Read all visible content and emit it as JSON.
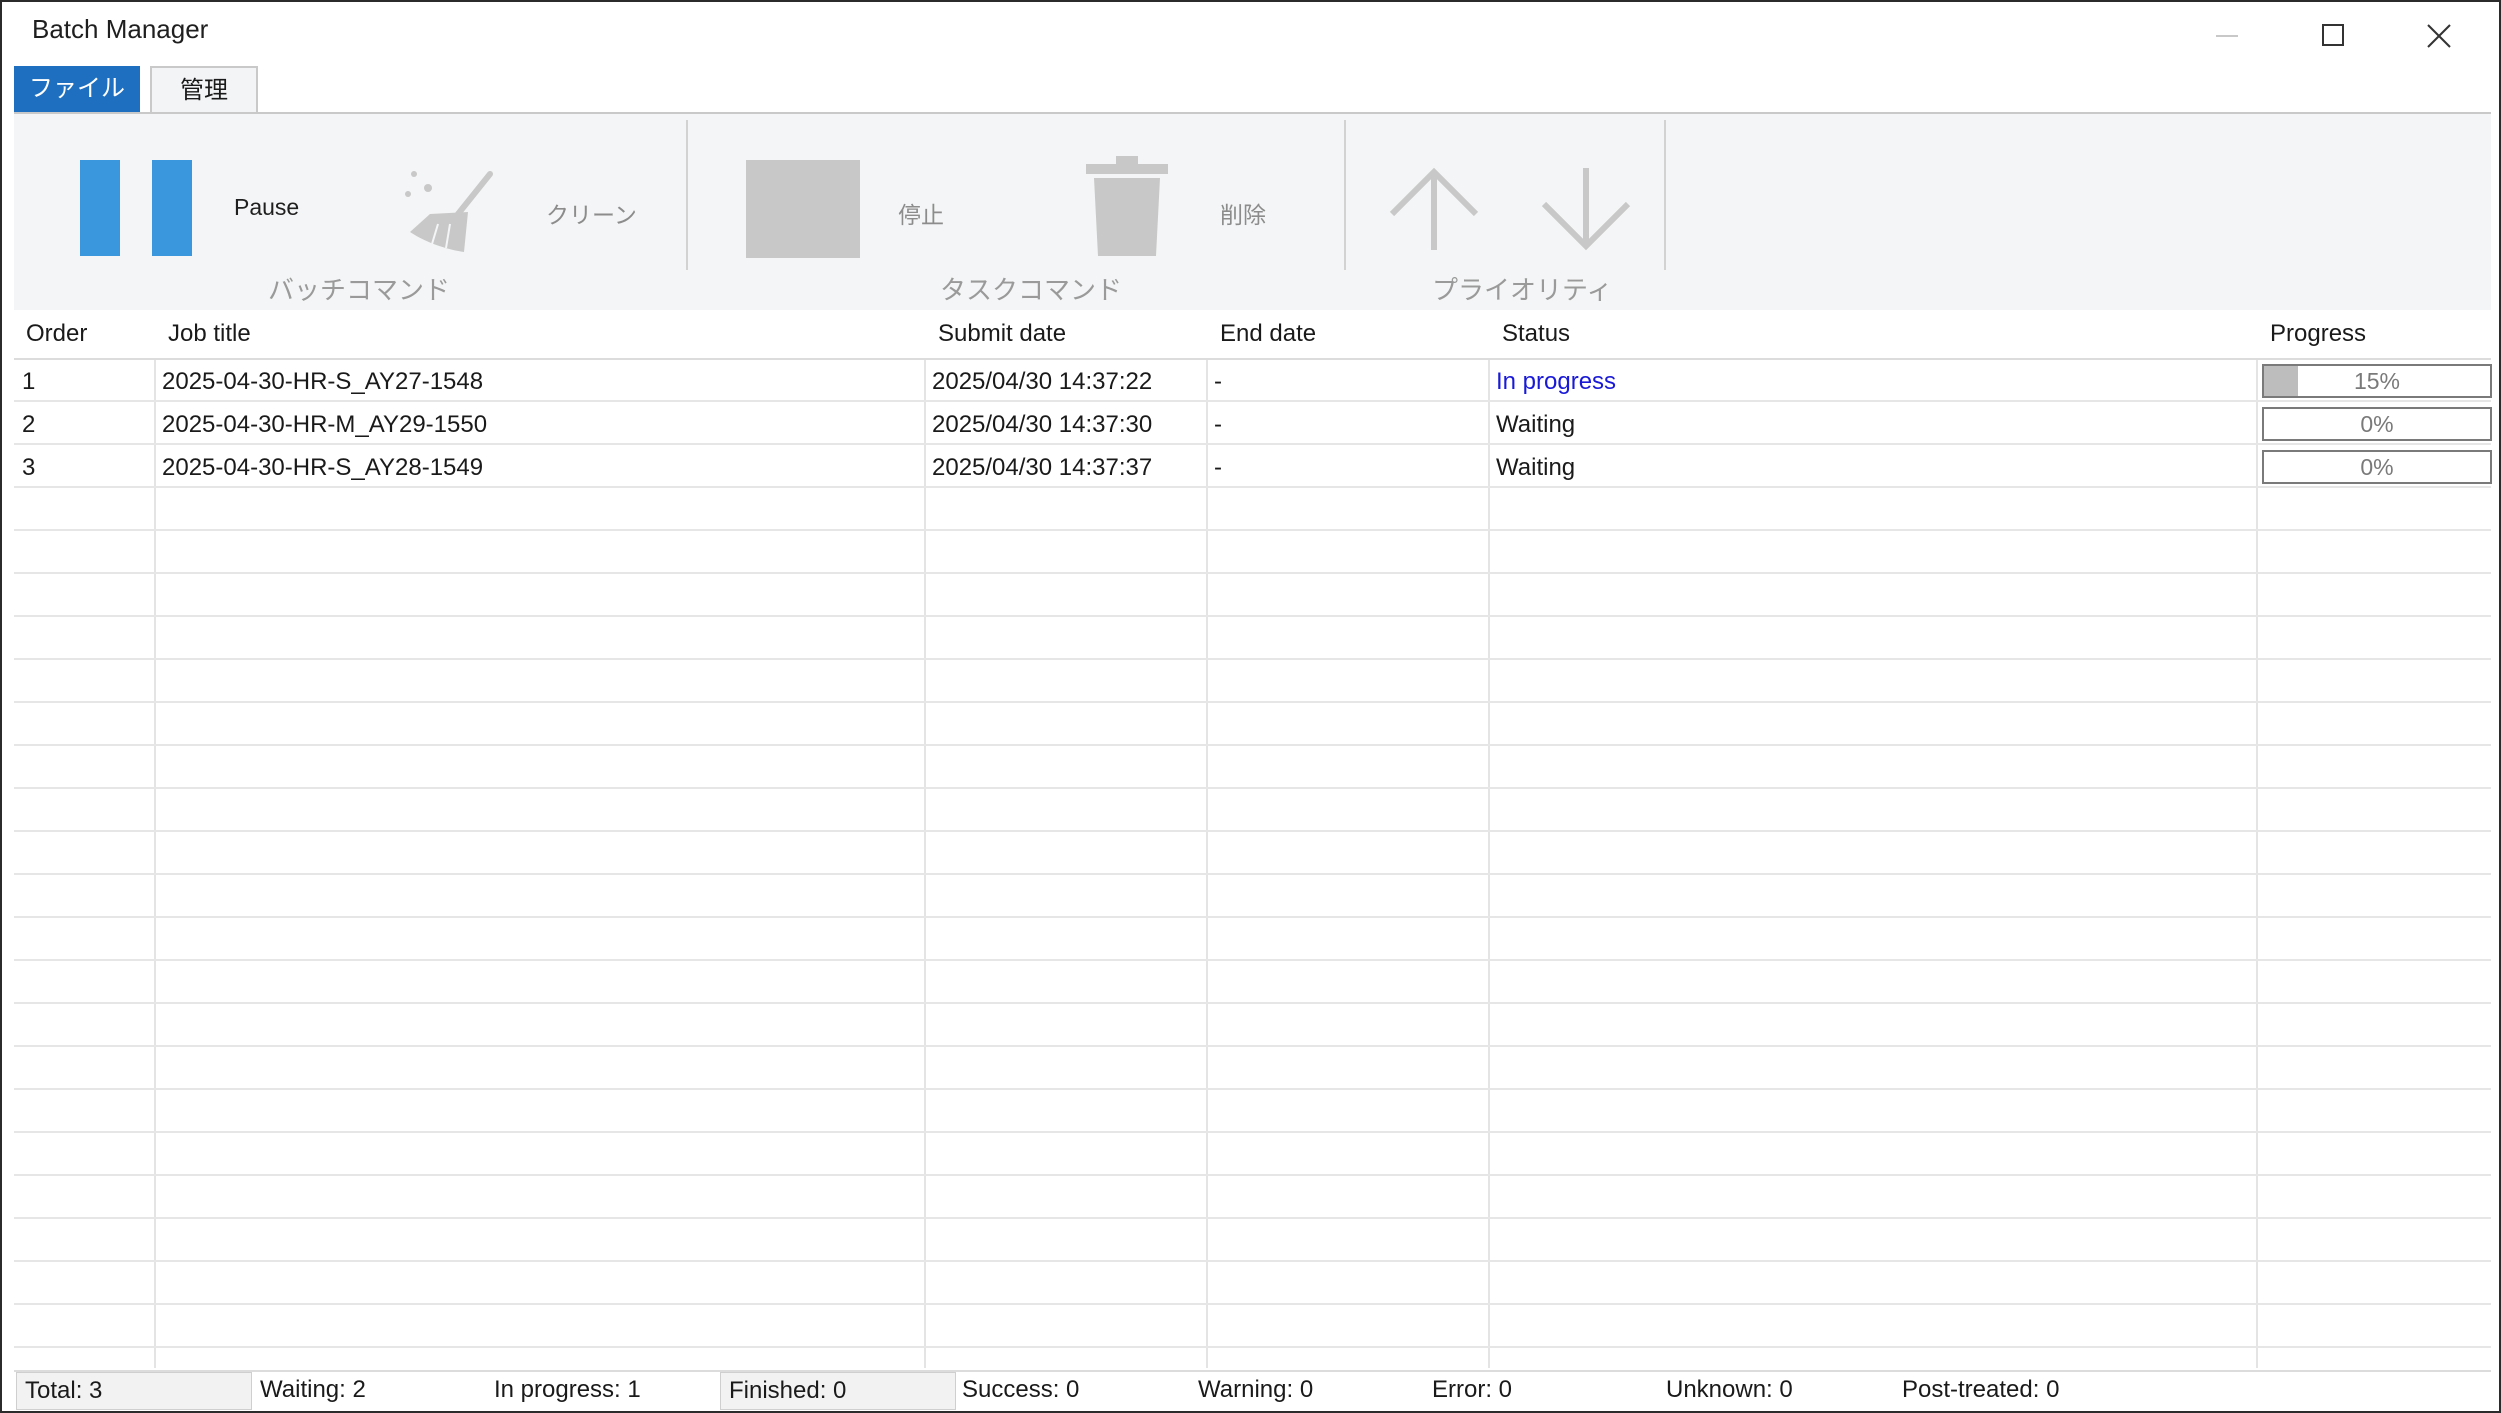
{
  "window": {
    "title": "Batch Manager"
  },
  "tabs": [
    {
      "label": "ファイル"
    },
    {
      "label": "管理"
    }
  ],
  "ribbon": {
    "pause_label": "Pause",
    "clean_label": "クリーン",
    "stop_label": "停止",
    "delete_label": "削除",
    "groups": {
      "batch": "バッチコマンド",
      "task": "タスクコマンド",
      "priority": "プライオリティ"
    },
    "colors": {
      "accent": "#3a96dd",
      "disabled": "#c8c8c8"
    }
  },
  "table": {
    "columns": [
      "Order",
      "Job title",
      "Submit date",
      "End date",
      "Status",
      "Progress"
    ],
    "rows": [
      {
        "order": "1",
        "title": "2025-04-30-HR-S_AY27-1548",
        "submit": "2025/04/30 14:37:22",
        "end": "-",
        "status": "In progress",
        "progress": 15,
        "progress_label": "15%"
      },
      {
        "order": "2",
        "title": "2025-04-30-HR-M_AY29-1550",
        "submit": "2025/04/30 14:37:30",
        "end": "-",
        "status": "Waiting",
        "progress": 0,
        "progress_label": "0%"
      },
      {
        "order": "3",
        "title": "2025-04-30-HR-S_AY28-1549",
        "submit": "2025/04/30 14:37:37",
        "end": "-",
        "status": "Waiting",
        "progress": 0,
        "progress_label": "0%"
      }
    ]
  },
  "status": {
    "total": "Total: 3",
    "waiting": "Waiting: 2",
    "in_progress": "In progress: 1",
    "finished": "Finished: 0",
    "success": "Success: 0",
    "warning": "Warning: 0",
    "error": "Error: 0",
    "unknown": "Unknown: 0",
    "post_treated": "Post-treated: 0"
  }
}
